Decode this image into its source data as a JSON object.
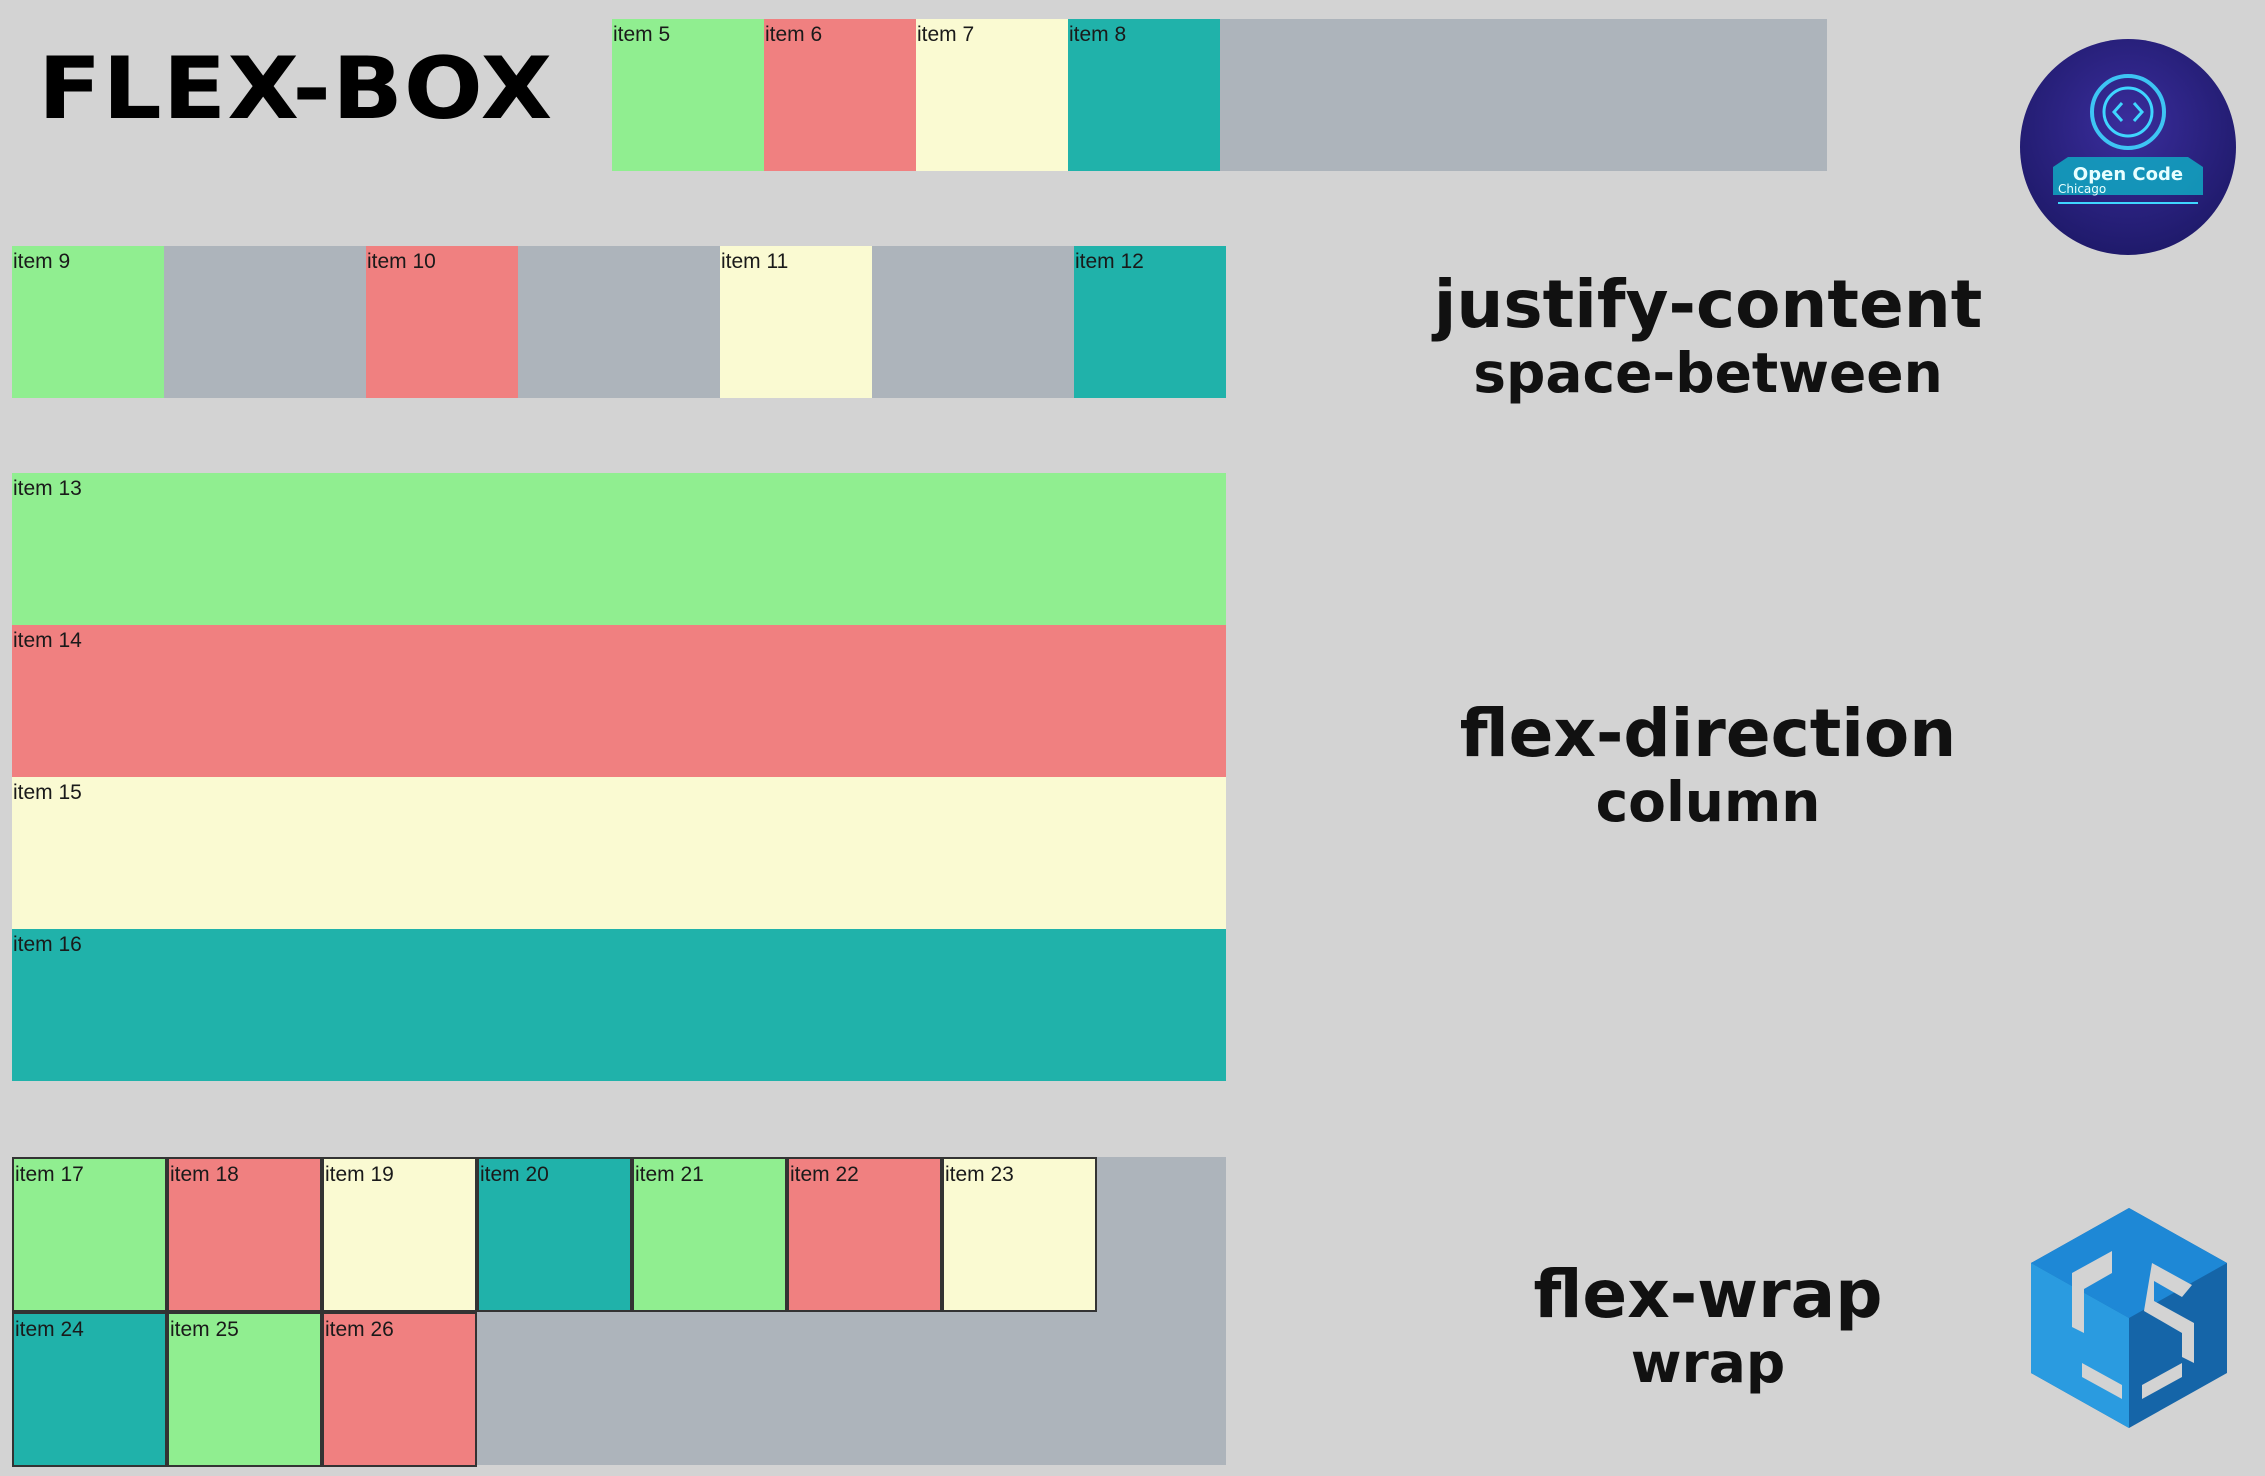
{
  "title": "FLEX-BOX",
  "row1": [
    "item 5",
    "item 6",
    "item 7",
    "item 8"
  ],
  "row2": [
    "item 9",
    "item 10",
    "item 11",
    "item 12"
  ],
  "column": [
    "item 13",
    "item 14",
    "item 15",
    "item 16"
  ],
  "wrap_items": [
    "item 17",
    "item 18",
    "item 19",
    "item 20",
    "item 21",
    "item 22",
    "item 23",
    "item 24",
    "item 25",
    "item 26"
  ],
  "labels": {
    "justify": {
      "main": "justify-content",
      "sub": "space-between"
    },
    "direction": {
      "main": "flex-direction",
      "sub": "column"
    },
    "wrap": {
      "main": "flex-wrap",
      "sub": "wrap"
    }
  },
  "logos": {
    "open_code": {
      "line1": "Open Code",
      "line2": "Chicago"
    }
  },
  "colors": {
    "green": "#90ee90",
    "red": "#f08080",
    "yellow": "#fafad2",
    "teal": "#20b2aa",
    "container": "#adb4bb",
    "background": "#d3d3d3"
  }
}
